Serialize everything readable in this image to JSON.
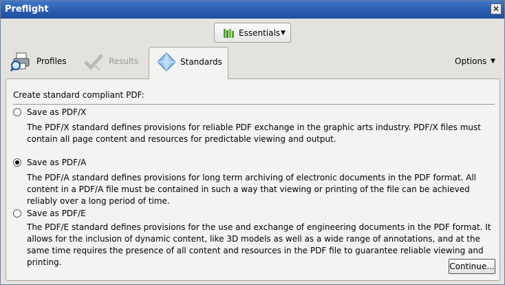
{
  "window": {
    "title": "Preflight",
    "close_icon": "close-icon"
  },
  "toolbar": {
    "essentials_label": "Essentials",
    "essentials_icon": "library-bars-icon"
  },
  "tabs": [
    {
      "label": "Profiles",
      "icon": "printer-magnifier-icon",
      "enabled": true
    },
    {
      "label": "Results",
      "icon": "checkmark-icon",
      "enabled": false
    },
    {
      "label": "Standards",
      "icon": "diamond-icon",
      "selected": true
    }
  ],
  "options": {
    "label": "Options"
  },
  "panel": {
    "heading": "Create standard compliant PDF:",
    "choices": [
      {
        "label": "Save as PDF/X",
        "checked": false,
        "description": "The PDF/X standard defines provisions for reliable PDF exchange in the graphic arts industry. PDF/X files must contain all page content and resources for predictable viewing and output."
      },
      {
        "label": "Save as PDF/A",
        "checked": true,
        "description": "The PDF/A standard defines provisions for long term archiving of electronic documents in the PDF format. All content in a PDF/A file must be contained in such a way that viewing or printing of the file can be achieved reliably over a long period of time."
      },
      {
        "label": "Save as PDF/E",
        "checked": false,
        "description": "The PDF/E standard defines provisions for the use and exchange of engineering documents in the PDF format. It allows for the inclusion of dynamic content, like 3D models as well as a wide range of annotations, and at the same time requires the presence of all content and resources in the PDF file to guarantee reliable viewing and printing."
      }
    ],
    "continue_label": "Continue..."
  },
  "colors": {
    "title_bar": "#2a5cb0",
    "essentials_icon": "#4ea52a",
    "results_disabled": "#b8b8b8",
    "diamond": "#6fa8dc"
  }
}
